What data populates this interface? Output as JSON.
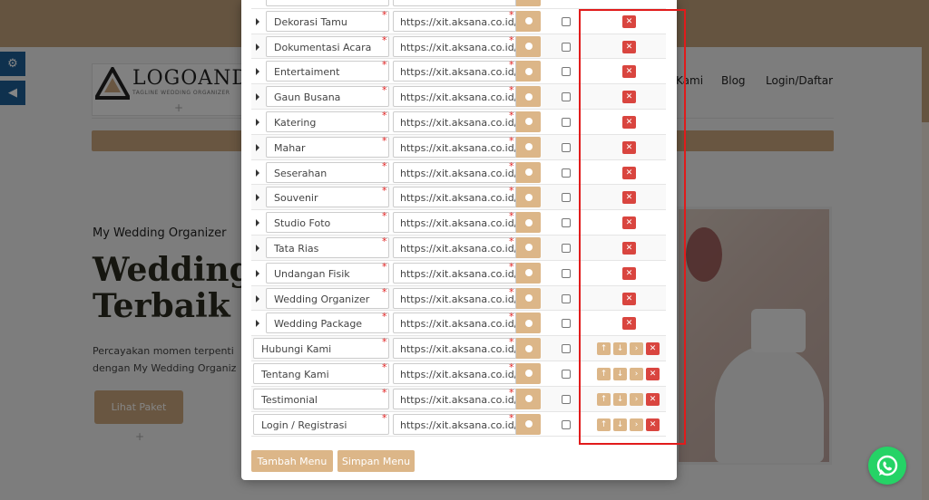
{
  "background": {
    "logo": {
      "text": "LOGOAND",
      "tagline": "TAGLINE WEDDING ORGANIZER"
    },
    "nav": [
      "Kami",
      "Blog",
      "Login/Daftar"
    ],
    "hero": {
      "subtitle": "My Wedding Organizer",
      "title_line1": "Wedding",
      "title_line2": "Terbaik",
      "para_line1": "Percayakan momen terpenti",
      "para_line2": "dengan My Wedding Organiz",
      "button": "Lihat Paket"
    }
  },
  "menu_rows": [
    {
      "name": "Dekorasi Tamu",
      "url": "https://xit.aksana.co.id/",
      "child": true
    },
    {
      "name": "Dokumentasi Acara",
      "url": "https://xit.aksana.co.id/",
      "child": true
    },
    {
      "name": "Entertaiment",
      "url": "https://xit.aksana.co.id/",
      "child": true
    },
    {
      "name": "Gaun Busana",
      "url": "https://xit.aksana.co.id/",
      "child": true
    },
    {
      "name": "Katering",
      "url": "https://xit.aksana.co.id/",
      "child": true
    },
    {
      "name": "Mahar",
      "url": "https://xit.aksana.co.id/",
      "child": true
    },
    {
      "name": "Seserahan",
      "url": "https://xit.aksana.co.id/",
      "child": true
    },
    {
      "name": "Souvenir",
      "url": "https://xit.aksana.co.id/",
      "child": true
    },
    {
      "name": "Studio Foto",
      "url": "https://xit.aksana.co.id/",
      "child": true
    },
    {
      "name": "Tata Rias",
      "url": "https://xit.aksana.co.id/",
      "child": true
    },
    {
      "name": "Undangan Fisik",
      "url": "https://xit.aksana.co.id/",
      "child": true
    },
    {
      "name": "Wedding Organizer",
      "url": "https://xit.aksana.co.id/",
      "child": true
    },
    {
      "name": "Wedding Package",
      "url": "https://xit.aksana.co.id/",
      "child": true
    },
    {
      "name": "Hubungi Kami",
      "url": "https://xit.aksana.co.id/",
      "child": false
    },
    {
      "name": "Tentang Kami",
      "url": "https://xit.aksana.co.id/",
      "child": false
    },
    {
      "name": "Testimonial",
      "url": "https://xit.aksana.co.id/",
      "child": false
    },
    {
      "name": "Login / Registrasi",
      "url": "https://xit.aksana.co.id/",
      "child": false
    }
  ],
  "required_mark": "*",
  "footer": {
    "add_menu": "Tambah Menu",
    "save_menu": "Simpan Menu"
  },
  "colors": {
    "accent": "#dcb688",
    "delete": "#d9453f",
    "highlight": "#e11b1b"
  }
}
